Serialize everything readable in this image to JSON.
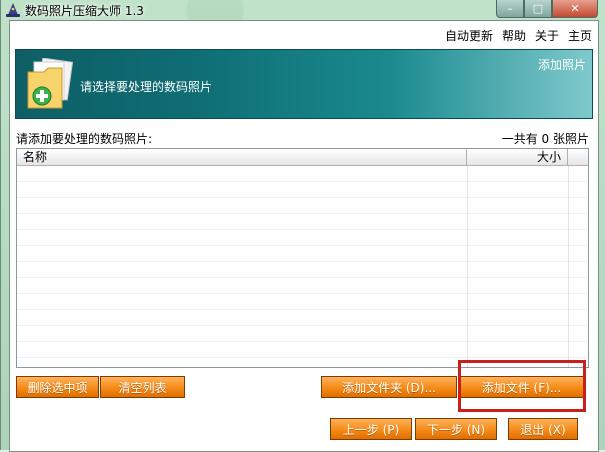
{
  "window": {
    "title": "数码照片压缩大师 1.3",
    "caption": {
      "minimize": "–",
      "maximize": "□",
      "close": "✕"
    }
  },
  "topmenu": {
    "auto_update": "自动更新",
    "help": "帮助",
    "about": "关于",
    "home": "主页"
  },
  "banner": {
    "prompt": "请选择要处理的数码照片",
    "link": "添加照片",
    "icon": "folder-add-icon"
  },
  "list": {
    "caption": "请添加要处理的数码照片:",
    "count_text": "一共有  0  张照片",
    "columns": [
      "名称",
      "大小"
    ]
  },
  "buttons": {
    "delete_selected": "删除选中项",
    "clear_list": "清空列表",
    "add_folder": "添加文件夹 (D)...",
    "add_file": "添加文件 (F)...",
    "prev": "上一步 (P)",
    "next": "下一步 (N)",
    "exit": "退出 (X)"
  },
  "colors": {
    "banner": "#0f5e66",
    "button": "#f58a18",
    "highlight": "#c8201a"
  }
}
